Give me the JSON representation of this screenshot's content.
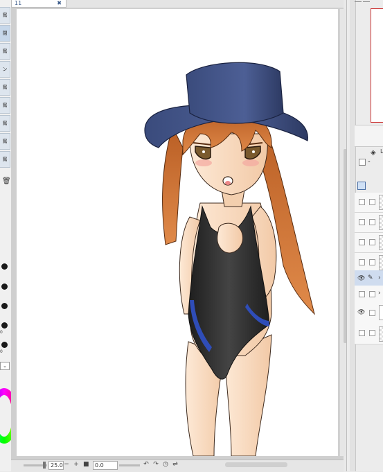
{
  "document": {
    "tab_title": "11",
    "close_glyph": "✖"
  },
  "left_toolbar": {
    "tabs": [
      "窵",
      "閉",
      "窵",
      "ン",
      "窵",
      "窵",
      "窵",
      "窵",
      "窵"
    ],
    "brush_size_labels": [
      "0",
      "0"
    ],
    "icons": [
      "trash-icon",
      "chevron-down-icon"
    ]
  },
  "status_bar": {
    "zoom_value": "25.0",
    "rotation_value": "0.0",
    "minus_label": "−",
    "plus_label": "+",
    "icons": [
      "zoom-out-icon",
      "zoom-in-icon",
      "fit-icon",
      "rotate-left-icon",
      "rotate-right-icon",
      "reset-rotation-icon",
      "flip-icon"
    ]
  },
  "right_panel": {
    "nav_label": "",
    "layer_icons": [
      "layer-icon",
      "pen-icon",
      "eye-icon"
    ],
    "blend_label": "レ",
    "layers": [
      {
        "visible": false,
        "selected": false
      },
      {
        "visible": false,
        "selected": false
      },
      {
        "visible": false,
        "selected": false
      },
      {
        "visible": false,
        "selected": false
      },
      {
        "visible": true,
        "selected": true
      },
      {
        "visible": false,
        "selected": false
      },
      {
        "visible": true,
        "selected": false
      },
      {
        "visible": false,
        "selected": false
      }
    ]
  },
  "colors": {
    "hat": "#3f5285",
    "hair": "#c46a2f",
    "skin": "#fbe3cc",
    "swimsuit": "#2a2a2a",
    "swimsuit_accent": "#2f4db8",
    "eyes": "#7a5a2e"
  }
}
